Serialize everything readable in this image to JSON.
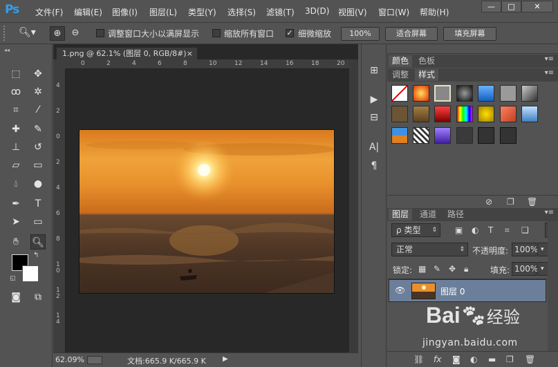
{
  "app": {
    "logo": "Ps",
    "menus": [
      "文件(F)",
      "编辑(E)",
      "图像(I)",
      "图层(L)",
      "类型(Y)",
      "选择(S)",
      "滤镜(T)",
      "3D(D)",
      "视图(V)",
      "窗口(W)",
      "帮助(H)"
    ],
    "window_buttons": [
      "—",
      "□",
      "✕"
    ]
  },
  "options": {
    "resize_windows_label": "调整窗口大小以满屏显示",
    "resize_windows_checked": false,
    "zoom_all_label": "缩放所有窗口",
    "zoom_all_checked": false,
    "scrubby_zoom_label": "细微缩放",
    "scrubby_zoom_checked": true,
    "btn_100": "100%",
    "btn_fit": "适合屏幕",
    "btn_fill": "填充屏幕"
  },
  "document": {
    "tab_title": "1.png @ 62.1% (图层 0, RGB/8#)",
    "tab_close": "×",
    "hruler_ticks": [
      "0",
      "2",
      "4",
      "6",
      "8",
      "10",
      "12",
      "14",
      "16",
      "18",
      "20"
    ],
    "vruler_ticks": [
      "4",
      "2",
      "0",
      "2",
      "4",
      "6",
      "8",
      "1\n0",
      "1\n2",
      "1\n4"
    ]
  },
  "status": {
    "zoom": "62.09%",
    "doc_info": "文档:665.9 K/665.9 K",
    "arrow": "▶"
  },
  "panels": {
    "color_tab": "颜色",
    "swatches_tab": "色板",
    "adjust_tab": "调整",
    "styles_tab": "样式",
    "layers_tab": "图层",
    "channels_tab": "通道",
    "paths_tab": "路径",
    "filter_kind": "类型",
    "blend_mode": "正常",
    "opacity_label": "不透明度:",
    "opacity_value": "100%",
    "lock_label": "锁定:",
    "fill_label": "填充:",
    "fill_value": "100%",
    "layer_name": "图层 0"
  },
  "watermark": {
    "brand": "Bai",
    "brand2": "经验",
    "url": "jingyan.baidu.com"
  },
  "colors": {
    "foreground": "#000000",
    "background": "#ffffff",
    "accent": "#2fa0f0",
    "selected_layer": "#6b7f9a"
  }
}
